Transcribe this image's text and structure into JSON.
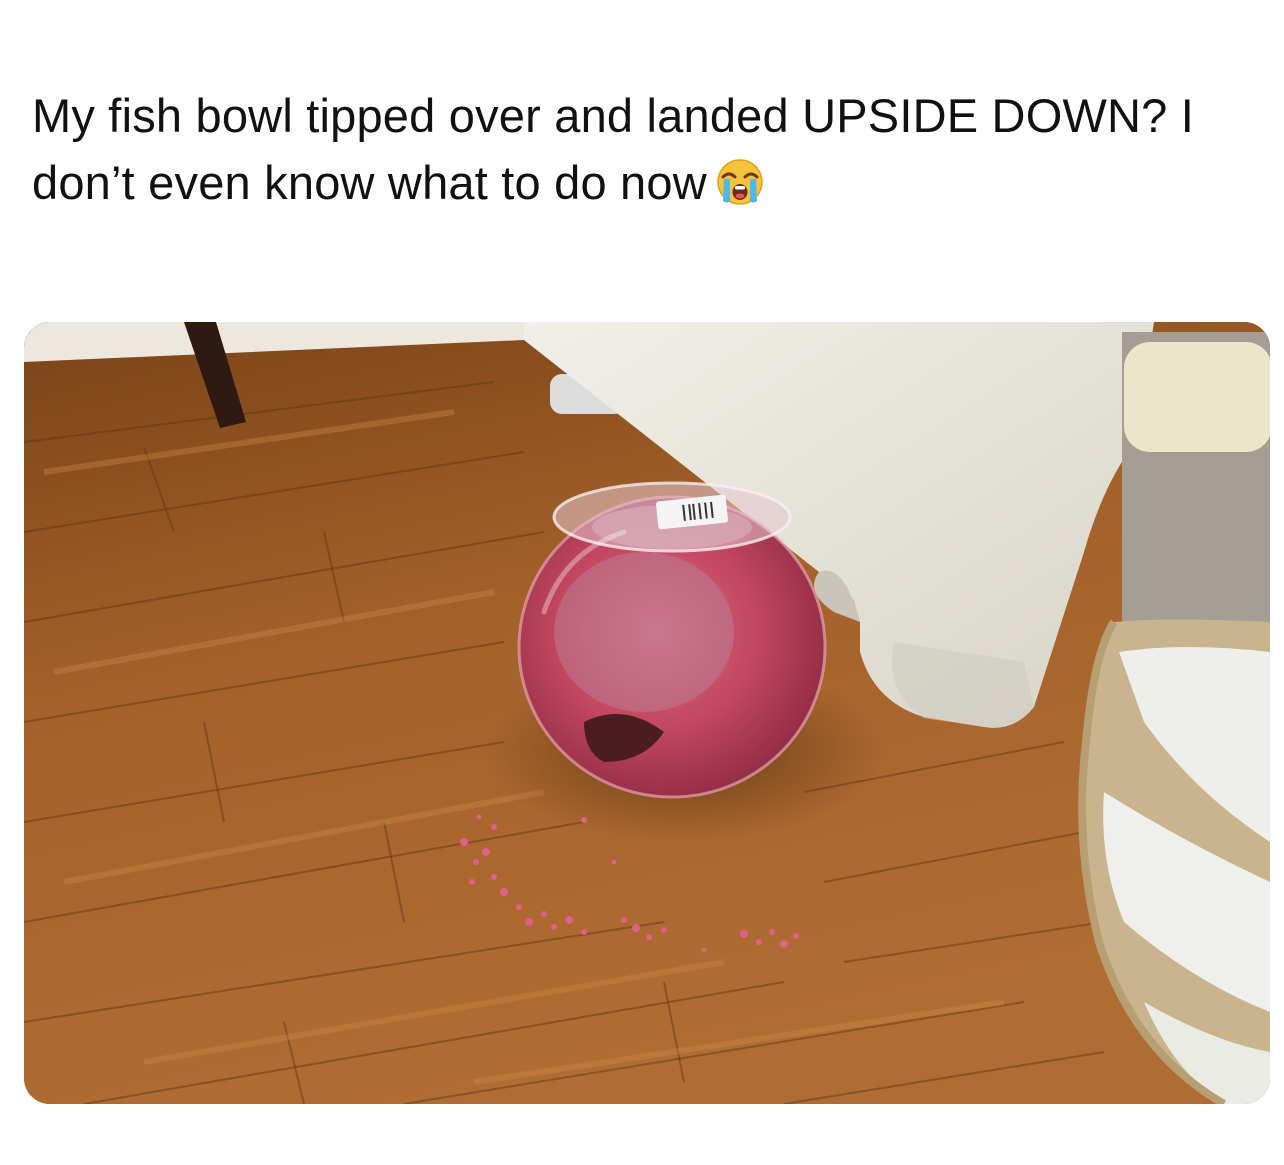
{
  "post": {
    "caption": "My fish bowl tipped over and landed UPSIDE DOWN? I don’t even know what to do now",
    "caption_emoji": "loudly-crying-face-icon"
  },
  "photo": {
    "bowl_label_text": ""
  },
  "colors": {
    "floor": "#9a5a25",
    "floor_light": "#c07a3a",
    "water": "#c2465f",
    "gravel": "#e0608a",
    "furniture": "#e9e6de",
    "rug_beige": "#c9b48e"
  }
}
